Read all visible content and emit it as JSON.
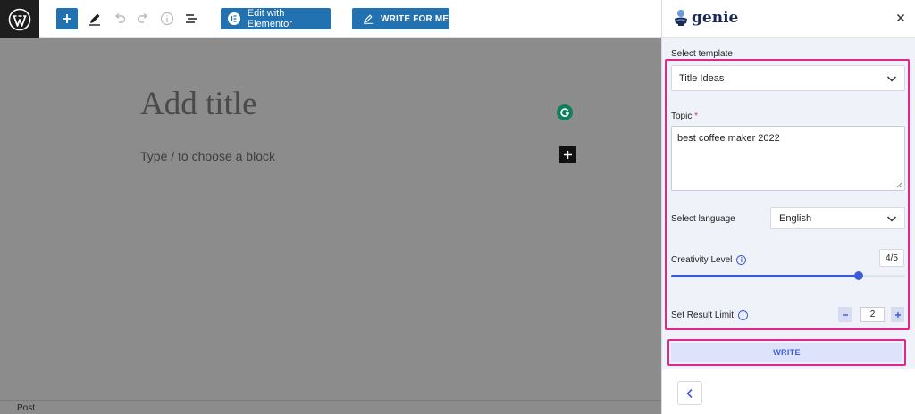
{
  "toolbar": {
    "elementor_label": "Edit with Elementor",
    "write_for_me_label": "WRITE FOR ME"
  },
  "editor": {
    "title_placeholder": "Add title",
    "block_placeholder": "Type / to choose a block"
  },
  "footer": {
    "breadcrumb": "Post"
  },
  "panel": {
    "brand": "genie",
    "select_template_label": "Select template",
    "template_value": "Title Ideas",
    "topic_label": "Topic",
    "topic_required": "*",
    "topic_value": "best coffee maker 2022",
    "select_language_label": "Select language",
    "language_value": "English",
    "creativity_label": "Creativity Level",
    "creativity_value": "4/5",
    "creativity_fraction": 0.8,
    "result_limit_label": "Set Result Limit",
    "result_limit_value": "2",
    "write_label": "WRITE"
  },
  "colors": {
    "wp_blue": "#2271b1",
    "accent_blue": "#3b5bdb",
    "highlight_pink": "#e0288a",
    "dim_overlay": "#8c8c8c"
  }
}
